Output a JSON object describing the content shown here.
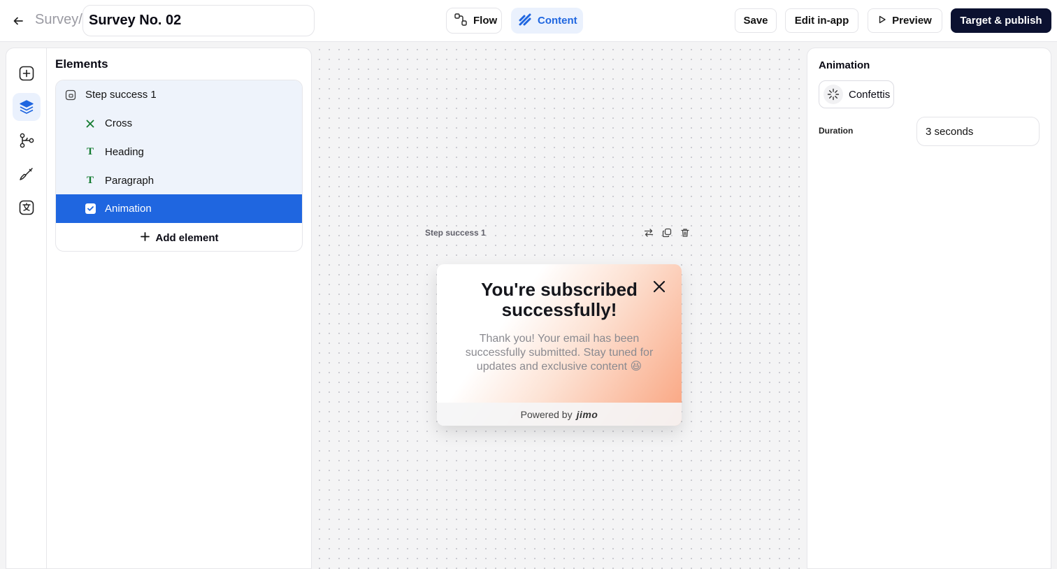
{
  "header": {
    "breadcrumb": "Survey/",
    "survey_name": "Survey No. 02",
    "tabs": [
      {
        "label": "Flow",
        "icon": "flow-icon"
      },
      {
        "label": "Content",
        "icon": "content-icon",
        "active": true
      }
    ],
    "save_label": "Save",
    "edit_label": "Edit in-app",
    "preview_label": "Preview",
    "publish_label": "Target & publish"
  },
  "rail": {
    "items": [
      "add-block-icon",
      "layers-icon",
      "branch-icon",
      "brush-icon",
      "translate-icon"
    ],
    "active": "layers-icon"
  },
  "elements": {
    "title": "Elements",
    "step": "Step success 1",
    "items": [
      {
        "label": "Cross",
        "icon": "cross-icon"
      },
      {
        "label": "Heading",
        "icon": "text-icon"
      },
      {
        "label": "Paragraph",
        "icon": "text-icon"
      },
      {
        "label": "Animation",
        "icon": "checkbox-icon",
        "selected": true
      }
    ],
    "add_label": "Add element"
  },
  "canvas": {
    "step_label": "Step success 1",
    "card": {
      "heading": "You're subscribed successfully!",
      "paragraph": "Thank you! Your email has been successfully submitted. Stay tuned for updates and exclusive content 😆",
      "powered_by": "Powered by",
      "brand": "jimo"
    }
  },
  "animation_panel": {
    "title": "Animation",
    "type": "Confettis",
    "duration_label": "Duration",
    "duration_value": "3 seconds"
  },
  "colors": {
    "accent": "#1f66e0",
    "accent_light": "#eaf1fd",
    "publish_bg": "#0b1130",
    "card_gradient_end": "#f9a37e"
  }
}
